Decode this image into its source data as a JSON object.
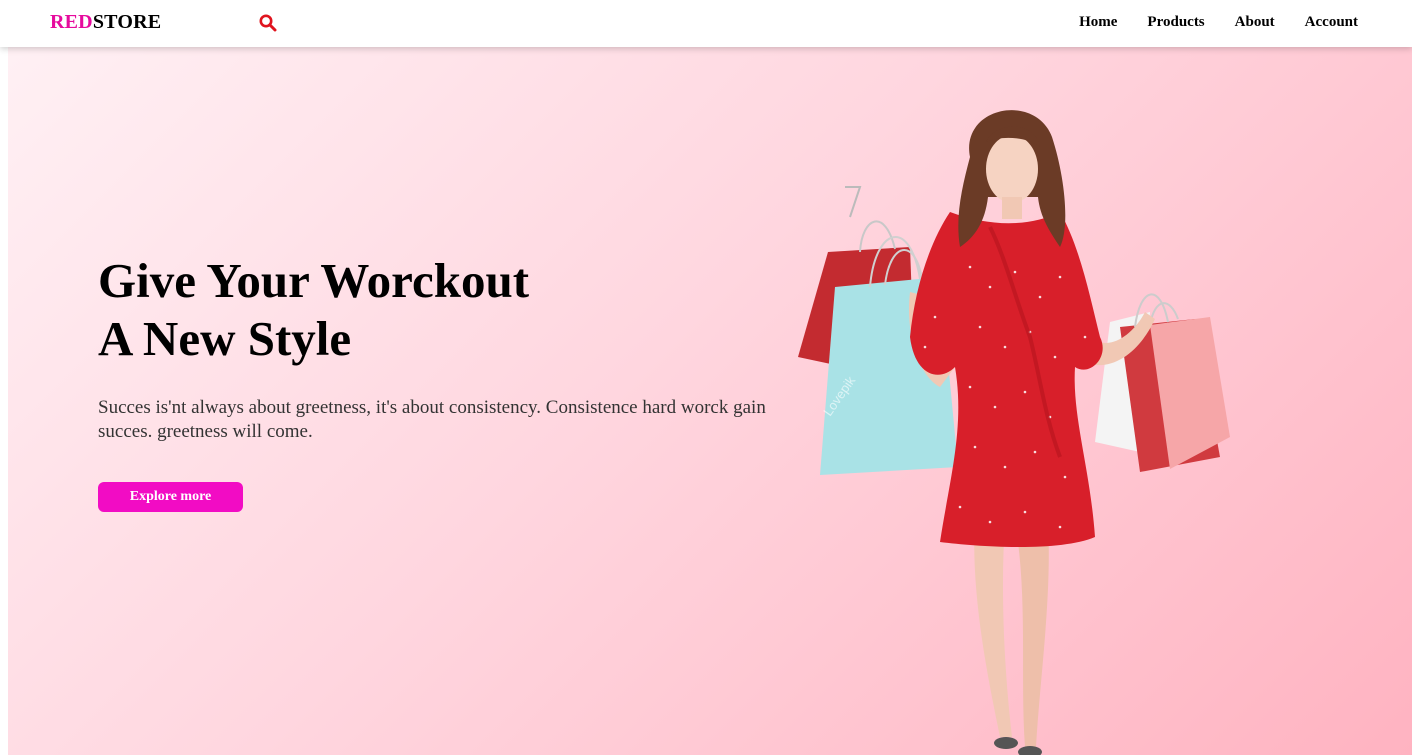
{
  "brand": {
    "primary": "RED",
    "secondary": "STORE",
    "accent_color": "#e60b9d"
  },
  "nav": {
    "search_icon": "search-icon",
    "links": [
      {
        "label": "Home"
      },
      {
        "label": "Products"
      },
      {
        "label": "About"
      },
      {
        "label": "Account"
      }
    ]
  },
  "hero": {
    "title_line1": "Give Your Worckout",
    "title_line2": "A New Style",
    "description": "Succes is'nt always about greetness, it's about consistency. Consistence hard worck gain succes. greetness will come.",
    "button_label": "Explore more",
    "button_color": "#f20cc4",
    "image_watermark": "Lovepik"
  }
}
